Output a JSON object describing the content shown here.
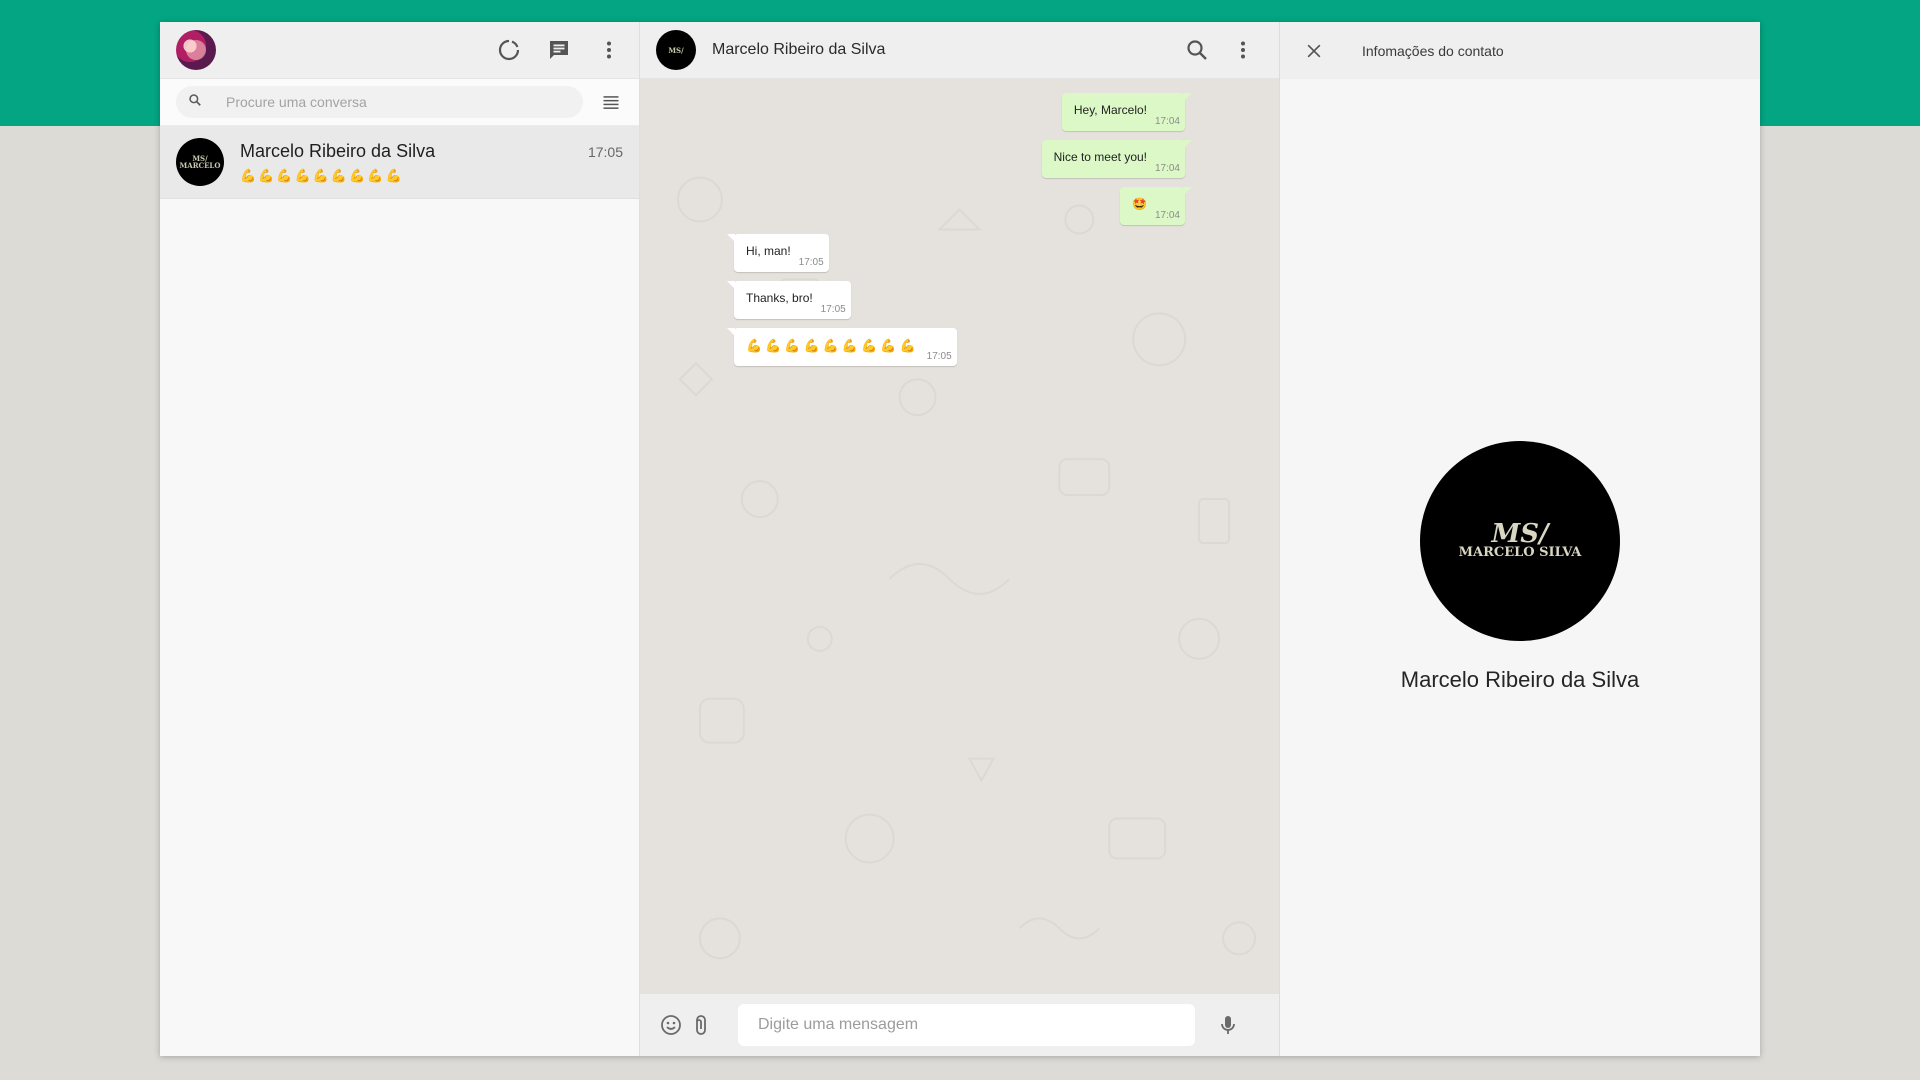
{
  "left": {
    "search_placeholder": "Procure uma conversa",
    "chats": [
      {
        "name": "Marcelo Ribeiro da Silva",
        "time": "17:05",
        "last_message": "💪💪💪💪💪💪💪💪💪"
      }
    ]
  },
  "chat": {
    "contact_name": "Marcelo Ribeiro da Silva",
    "messages": [
      {
        "direction": "out",
        "text": "Hey, Marcelo!",
        "time": "17:04"
      },
      {
        "direction": "out",
        "text": "Nice to meet you!",
        "time": "17:04"
      },
      {
        "direction": "out",
        "text": "🤩",
        "time": "17:04"
      },
      {
        "direction": "in",
        "text": "Hi, man!",
        "time": "17:05"
      },
      {
        "direction": "in",
        "text": "Thanks, bro!",
        "time": "17:05"
      },
      {
        "direction": "in",
        "text": "💪💪💪💪💪💪💪💪💪",
        "time": "17:05"
      }
    ],
    "composer_placeholder": "Digite uma mensagem"
  },
  "contact_info": {
    "title": "Infomações do contato",
    "name": "Marcelo Ribeiro da Silva",
    "avatar_logo_line1": "MS/",
    "avatar_logo_line2": "MARCELO SILVA"
  },
  "colors": {
    "brand_band": "#03a582",
    "outgoing_bubble": "#dbf8c6",
    "incoming_bubble": "#ffffff",
    "chat_background": "#e5e1dc"
  },
  "icons": {
    "left_header": [
      "status-icon",
      "new-chat-icon",
      "menu-dots-icon"
    ],
    "search": "search-icon",
    "filter": "filter-icon",
    "chat_header": [
      "search-icon",
      "menu-dots-icon"
    ],
    "composer": [
      "emoji-icon",
      "attach-icon",
      "mic-icon"
    ],
    "contact_info": [
      "close-icon"
    ]
  }
}
